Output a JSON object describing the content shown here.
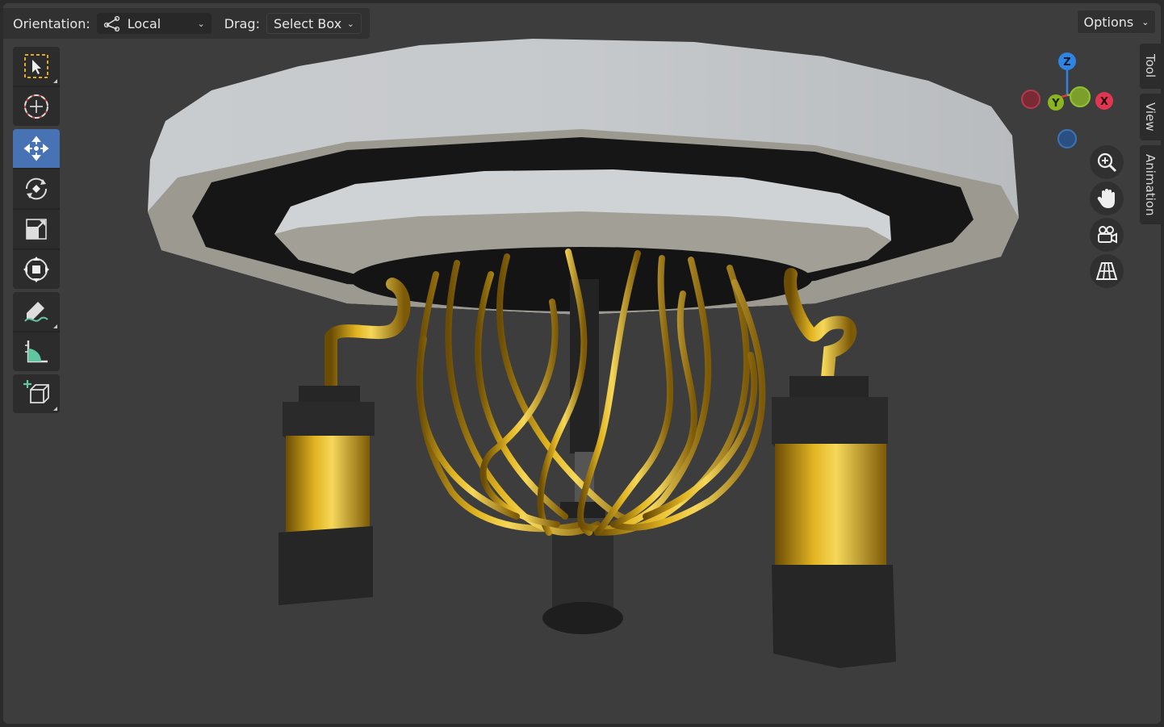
{
  "header": {
    "orientation_label": "Orientation:",
    "orientation_value": "Local",
    "drag_label": "Drag:",
    "drag_value": "Select Box",
    "options_label": "Options"
  },
  "toolbar": {
    "tools": [
      {
        "name": "select-box",
        "icon": "select-box-icon",
        "active": false
      },
      {
        "name": "cursor",
        "icon": "cursor-icon",
        "active": false
      },
      {
        "name": "move",
        "icon": "move-icon",
        "active": true
      },
      {
        "name": "rotate",
        "icon": "rotate-icon",
        "active": false
      },
      {
        "name": "scale",
        "icon": "scale-icon",
        "active": false
      },
      {
        "name": "transform",
        "icon": "transform-icon",
        "active": false
      },
      {
        "name": "annotate",
        "icon": "annotate-icon",
        "active": false
      },
      {
        "name": "measure",
        "icon": "measure-icon",
        "active": false
      },
      {
        "name": "add-cube",
        "icon": "add-cube-icon",
        "active": false
      }
    ]
  },
  "sidebar_tabs": [
    "Tool",
    "View",
    "Animation"
  ],
  "gizmo": {
    "x_label": "X",
    "y_label": "Y",
    "z_label": "Z",
    "colors": {
      "x": "#e0364f",
      "y": "#8ab521",
      "z": "#2f83e3"
    }
  },
  "nav_buttons": [
    "zoom-icon",
    "hand-pan-icon",
    "camera-icon",
    "grid-icon"
  ],
  "theme": {
    "active_tool": "#4772b3",
    "viewport_bg": "#3d3d3d"
  }
}
